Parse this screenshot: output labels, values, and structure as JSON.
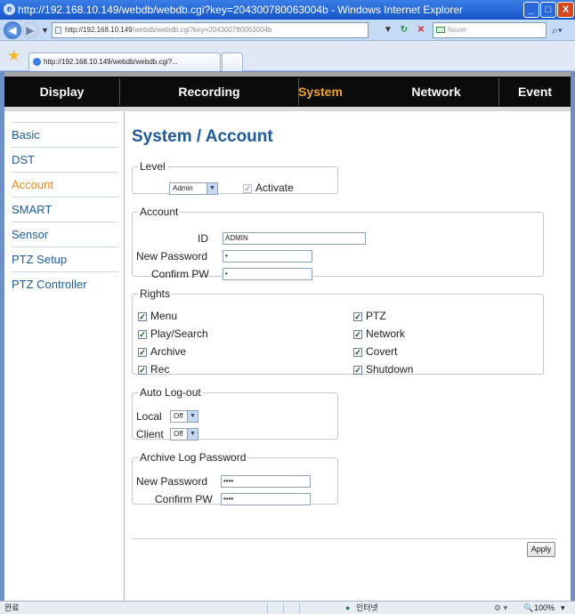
{
  "window": {
    "title": "http://192.168.10.149/webdb/webdb.cgi?key=204300780063004b - Windows Internet Explorer",
    "address_host": "http://192.168.10.149",
    "address_path": "/webdb/webdb.cgi?key=204300780063004b",
    "search_placeholder": "Naver",
    "tab_title": "http://192.168.10.149/webdb/webdb.cgi?..."
  },
  "topnav": [
    "Display",
    "Recording",
    "System",
    "Network",
    "Event"
  ],
  "sidebar": [
    "Basic",
    "DST",
    "Account",
    "SMART",
    "Sensor",
    "PTZ Setup",
    "PTZ Controller"
  ],
  "page": {
    "title": "System / Account",
    "level": {
      "legend": "Level",
      "select": "Admin",
      "activate_label": "Activate"
    },
    "account": {
      "legend": "Account",
      "id_label": "ID",
      "id_value": "ADMIN",
      "new_password_label": "New Password",
      "new_password_value": "•",
      "confirm_label": "Confirm PW",
      "confirm_value": "•"
    },
    "rights": {
      "legend": "Rights",
      "left": [
        "Menu",
        "Play/Search",
        "Archive",
        "Rec"
      ],
      "right": [
        "PTZ",
        "Network",
        "Covert",
        "Shutdown"
      ]
    },
    "auto_logout": {
      "legend": "Auto Log-out",
      "local_label": "Local",
      "local_value": "Off",
      "client_label": "Client",
      "client_value": "Off"
    },
    "archive_log": {
      "legend": "Archive Log Password",
      "new_password_label": "New Password",
      "new_password_value": "••••",
      "confirm_label": "Confirm PW",
      "confirm_value": "••••"
    },
    "apply_label": "Apply"
  },
  "statusbar": {
    "left": "완료",
    "zone": "인터넷",
    "zoom": "100%"
  },
  "colors": {
    "nav_bg": "#0b0b0b",
    "nav_selected": "#f0a22e",
    "link": "#1e5c9a",
    "sidebar_selected": "#e98a18",
    "heading": "#1f5a99"
  }
}
